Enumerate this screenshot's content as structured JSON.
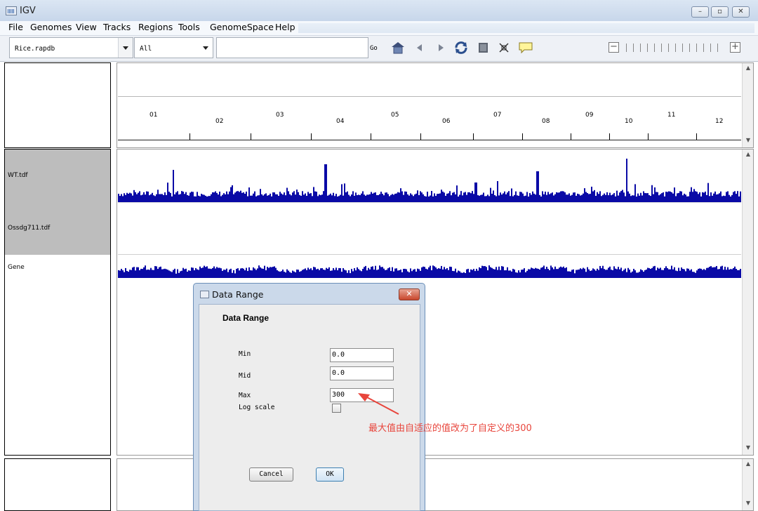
{
  "window": {
    "title": "IGV"
  },
  "menu": [
    "File",
    "Genomes",
    "View",
    "Tracks",
    "Regions",
    "Tools",
    "GenomeSpace",
    "Help"
  ],
  "toolbar": {
    "genome": "Rice.rapdb",
    "chromosome": "All",
    "locus_value": "",
    "go_label": "Go"
  },
  "ruler": {
    "chromosomes": [
      "01",
      "02",
      "03",
      "04",
      "05",
      "06",
      "07",
      "08",
      "09",
      "10",
      "11",
      "12"
    ]
  },
  "tracks": [
    {
      "name": "WT.tdf"
    },
    {
      "name": "Ossdg711.tdf"
    },
    {
      "name": "Gene"
    }
  ],
  "dialog": {
    "title": "Data Range",
    "heading": "Data Range",
    "min_label": "Min",
    "min_value": "0.0",
    "mid_label": "Mid",
    "mid_value": "0.0",
    "max_label": "Max",
    "max_value": "300",
    "log_label": "Log scale",
    "log_checked": false,
    "cancel_label": "Cancel",
    "ok_label": "OK"
  },
  "annotation": "最大值由自适应的值改为了自定义的300",
  "colors": {
    "track": "#0a0aa6",
    "annotation": "#e8453c"
  }
}
